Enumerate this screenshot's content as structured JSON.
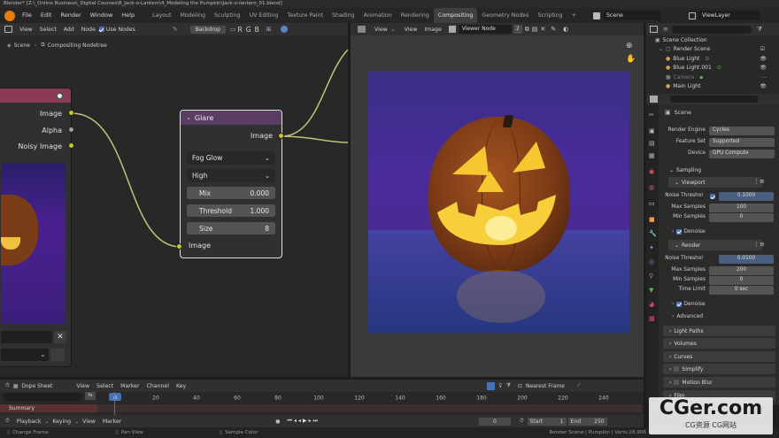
{
  "window": {
    "title": "Blender* [Z:\\_Online Business\\_Digital Courses\\8_Jack-o-Lantern\\4_Modeling the Pumpkin\\Jack-o-lantern_01.blend]"
  },
  "menu": [
    "File",
    "Edit",
    "Render",
    "Window",
    "Help"
  ],
  "workspaces": [
    "Layout",
    "Modeling",
    "Sculpting",
    "UV Editing",
    "Texture Paint",
    "Shading",
    "Animation",
    "Rendering",
    "Compositing",
    "Geometry Nodes",
    "Scripting"
  ],
  "active_workspace": "Compositing",
  "scene_field": "Scene",
  "viewlayer_field": "ViewLayer",
  "node_editor": {
    "menus": [
      "View",
      "Select",
      "Add",
      "Node"
    ],
    "use_nodes_label": "Use Nodes",
    "backdrop_label": "Backdrop",
    "channels": [
      "R",
      "G",
      "B"
    ],
    "breadcrumb": [
      "Scene",
      "Compositing Nodetree"
    ],
    "render_layers_outputs": [
      "Image",
      "Alpha",
      "Noisy Image"
    ],
    "glare_node": {
      "title": "Glare",
      "output": "Image",
      "type": "Fog Glow",
      "quality": "High",
      "mix_label": "Mix",
      "mix_value": "0.000",
      "threshold_label": "Threshold",
      "threshold_value": "1.000",
      "size_label": "Size",
      "size_value": "8",
      "input": "Image"
    }
  },
  "image_editor": {
    "menus": [
      "View",
      "View",
      "Image"
    ],
    "viewer_label": "Viewer Node",
    "slot": "2"
  },
  "outliner": {
    "search_placeholder": "",
    "root": "Scene Collection",
    "items": [
      {
        "label": "Render Scene"
      },
      {
        "label": "Blue Light"
      },
      {
        "label": "Blue Light.001"
      },
      {
        "label": "Camera"
      },
      {
        "label": "Main Light"
      }
    ]
  },
  "properties": {
    "title": "Scene",
    "render_engine_label": "Render Engine",
    "render_engine": "Cycles",
    "feature_set_label": "Feature Set",
    "feature_set": "Supported",
    "device_label": "Device",
    "device": "GPU Compute",
    "sampling": "Sampling",
    "viewport": "Viewport",
    "noise_threshold_label": "Noise Threshol",
    "viewport_noise": "0.1000",
    "max_samples_label": "Max Samples",
    "viewport_max": "100",
    "min_samples_label": "Min Samples",
    "viewport_min": "0",
    "denoise_label": "Denoise",
    "render": "Render",
    "render_noise": "0.0100",
    "render_max": "200",
    "render_min": "0",
    "time_limit_label": "Time Limit",
    "time_limit": "0 sec",
    "advanced": "Advanced",
    "panels": [
      "Light Paths",
      "Volumes",
      "Curves",
      "Simplify",
      "Motion Blur",
      "Film"
    ]
  },
  "timeline": {
    "mode": "Dope Sheet",
    "menus": [
      "View",
      "Select",
      "Marker",
      "Channel",
      "Key"
    ],
    "nearest_frame": "Nearest Frame",
    "ticks": [
      "0",
      "20",
      "40",
      "60",
      "80",
      "100",
      "120",
      "140",
      "160",
      "180",
      "200",
      "220",
      "240"
    ],
    "summary": "Summary",
    "playback_menus": [
      "Playback",
      "Keying",
      "View",
      "Marker"
    ],
    "current_frame": "0",
    "start_label": "Start",
    "start": "1",
    "end_label": "End",
    "end": "250"
  },
  "status": {
    "items": [
      "Change Frame",
      "Pan View",
      "Sample Color"
    ],
    "right": "Render Scene | Pumpkin | Verts:28,906"
  },
  "watermark": {
    "title": "CGer.com",
    "subtitle": "CG资源 CG网站"
  },
  "colors": {
    "accent": "#4772b3",
    "socket": "#c7c729",
    "glare_header": "#5a3d63",
    "timeline_marker": "#4772b3"
  }
}
